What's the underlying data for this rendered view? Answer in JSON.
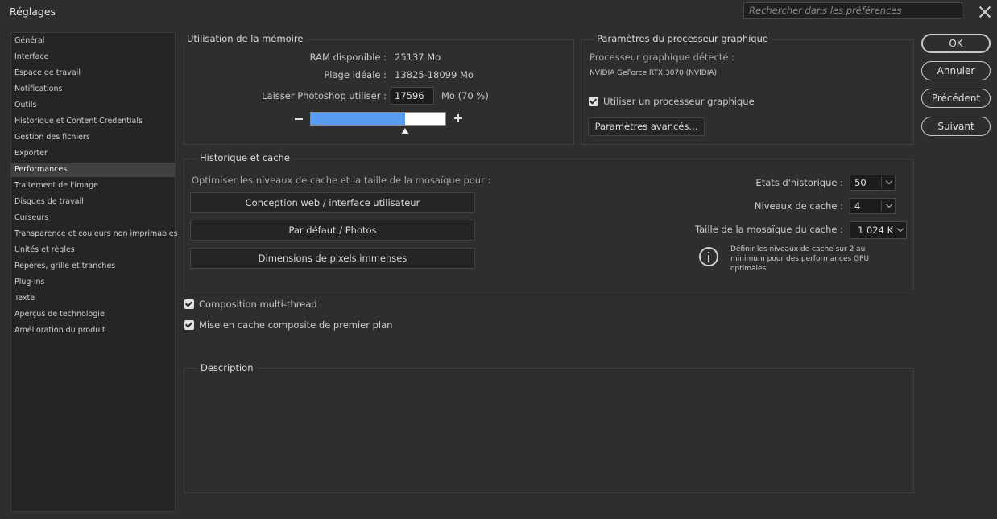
{
  "window": {
    "title": "Réglages"
  },
  "search": {
    "placeholder": "Rechercher dans les préférences"
  },
  "sidebar": {
    "items": [
      {
        "label": "Général"
      },
      {
        "label": "Interface"
      },
      {
        "label": "Espace de travail"
      },
      {
        "label": "Notifications"
      },
      {
        "label": "Outils"
      },
      {
        "label": "Historique et Content Credentials"
      },
      {
        "label": "Gestion des fichiers"
      },
      {
        "label": "Exporter"
      },
      {
        "label": "Performances",
        "selected": true
      },
      {
        "label": "Traitement de l'image"
      },
      {
        "label": "Disques de travail"
      },
      {
        "label": "Curseurs"
      },
      {
        "label": "Transparence et couleurs non imprimables"
      },
      {
        "label": "Unités et règles"
      },
      {
        "label": "Repères, grille et tranches"
      },
      {
        "label": "Plug-ins"
      },
      {
        "label": "Texte"
      },
      {
        "label": "Aperçus de technologie"
      },
      {
        "label": "Amélioration du produit"
      }
    ]
  },
  "memory": {
    "title": "Utilisation de la mémoire",
    "ram_label": "RAM disponible :",
    "ram_value": "25137 Mo",
    "ideal_label": "Plage idéale :",
    "ideal_value": "13825-18099 Mo",
    "let_label": "Laisser Photoshop utiliser :",
    "let_value": "17596",
    "let_unit": "Mo (70 %)",
    "slider_fraction": 0.7
  },
  "gpu": {
    "title": "Paramètres du processeur graphique",
    "detected_label": "Processeur graphique détecté :",
    "detected_value": "NVIDIA GeForce RTX 3070 (NVIDIA)",
    "use_gpu_label": "Utiliser un processeur graphique",
    "use_gpu_checked": true,
    "advanced_button": "Paramètres avancés..."
  },
  "history_cache": {
    "title": "Historique et cache",
    "optimize_label": "Optimiser les niveaux de cache et la taille de la mosaïque pour :",
    "buttons": [
      "Conception web / interface utilisateur",
      "Par défaut / Photos",
      "Dimensions de pixels immenses"
    ],
    "history_states_label": "Etats d'historique :",
    "history_states_value": "50",
    "cache_levels_label": "Niveaux de cache :",
    "cache_levels_value": "4",
    "tile_size_label": "Taille de la mosaïque du cache :",
    "tile_size_value": "1 024 K",
    "info_line1": "Définir les niveaux de cache sur 2 au",
    "info_line2": "minimum pour des performances GPU",
    "info_line3": "optimales"
  },
  "options": {
    "multithread_label": "Composition multi-thread",
    "multithread_checked": true,
    "foreground_cache_label": "Mise en cache composite de premier plan",
    "foreground_cache_checked": true
  },
  "description": {
    "title": "Description"
  },
  "actions": {
    "ok": "OK",
    "cancel": "Annuler",
    "previous": "Précédent",
    "next": "Suivant"
  }
}
